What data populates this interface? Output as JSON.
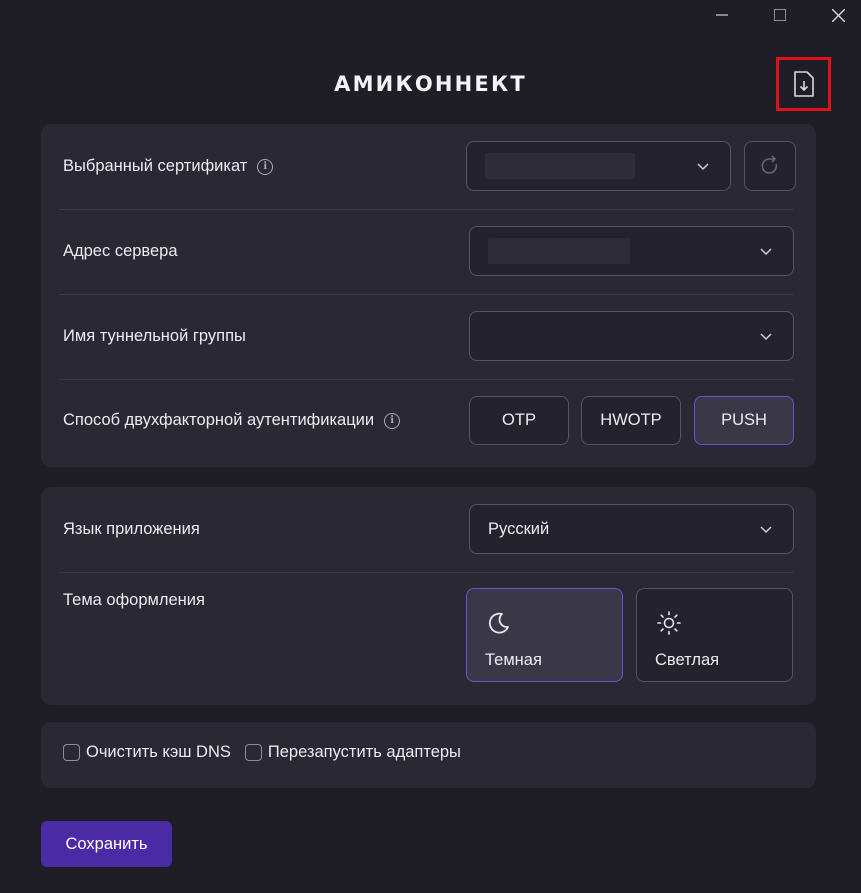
{
  "app": {
    "title": "АМИКОННЕКТ"
  },
  "window_controls": {
    "minimize_icon": "minimize-icon",
    "maximize_icon": "maximize-icon",
    "close_icon": "close-icon"
  },
  "connection": {
    "certificate_label": "Выбранный сертификат",
    "server_label": "Адрес сервера",
    "tunnel_group_label": "Имя туннельной группы",
    "twofa_label": "Способ двухфакторной аутентификации",
    "twofa_options": [
      "OTP",
      "HWOTP",
      "PUSH"
    ],
    "twofa_selected": "PUSH"
  },
  "appearance": {
    "language_label": "Язык приложения",
    "language_value": "Русский",
    "theme_label": "Тема оформления",
    "themes": [
      "Темная",
      "Светлая"
    ],
    "theme_selected": "Темная"
  },
  "options": {
    "clear_dns": "Очистить кэш DNS",
    "restart_adapters": "Перезапустить адаптеры"
  },
  "save_label": "Сохранить",
  "colors": {
    "accent": "#6e4fd8",
    "save_button": "#4b2aa6",
    "highlight_box": "#e0101a",
    "background": "#1f1e27",
    "panel": "#292833"
  }
}
